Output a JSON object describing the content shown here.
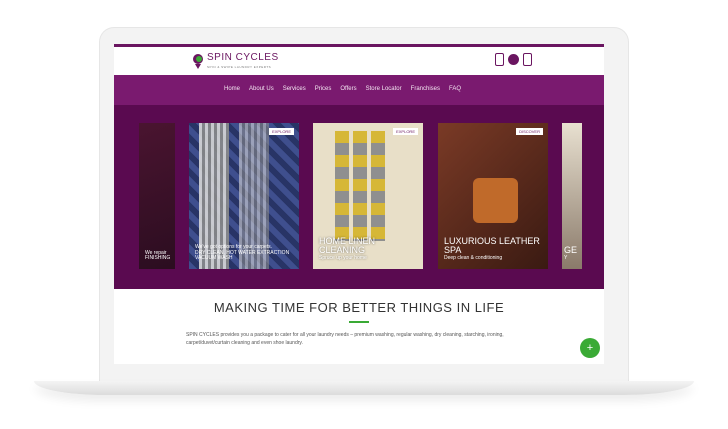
{
  "brand": {
    "title": "SPIN CYCLES",
    "subtitle": "SPIN & SWIPE LAUNDRY EXPERTS"
  },
  "header_icons": [
    "mobile-icon",
    "user-icon",
    "cart-icon"
  ],
  "nav": {
    "items": [
      "Home",
      "About Us",
      "Services",
      "Prices",
      "Offers",
      "Store Locator",
      "Franchises",
      "FAQ"
    ]
  },
  "carousel": {
    "cards": [
      {
        "badge": "",
        "caption_lines": [
          "We repair",
          "FINISHING"
        ]
      },
      {
        "badge": "EXPLORE",
        "caption_lines": [
          "We've got options for your carpets.",
          "DRY CLEAN, HOT WATER EXTRACTION",
          "VACUUM WASH"
        ]
      },
      {
        "badge": "EXPLORE",
        "caption_lines": [
          "HOME LINEN CLEANING",
          "Spruce up your home"
        ]
      },
      {
        "badge": "DISCOVER",
        "caption_lines": [
          "LUXURIOUS LEATHER SPA",
          "Deep clean & conditioning"
        ]
      },
      {
        "badge": "",
        "caption_lines": [
          "GE",
          "Y"
        ]
      }
    ]
  },
  "main": {
    "title": "MAKING TIME FOR BETTER THINGS IN LIFE",
    "paragraph": "SPIN CYCLES provides you a package to cater for all your laundry needs – premium washing, regular washing, dry cleaning, starching, ironing, carpet/duvet/curtain cleaning and even shoe laundry."
  },
  "fab_label": "+",
  "colors": {
    "brand_purple": "#7a1a6f",
    "accent_green": "#3aaa35"
  }
}
